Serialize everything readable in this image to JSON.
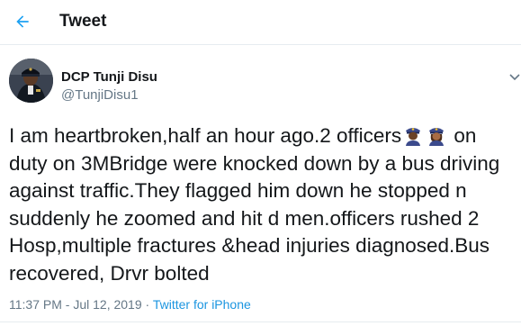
{
  "header": {
    "title": "Tweet",
    "back_icon": "arrow-left-icon",
    "accent": "#1da1f2"
  },
  "author": {
    "name": "DCP Tunji Disu",
    "handle": "@TunjiDisu1",
    "avatar_icon": "profile-photo"
  },
  "tweet": {
    "lines": [
      {
        "before": "I am heartbroken,half an hour ago.2 officers",
        "after": "on",
        "emoji": [
          "police-officer-icon",
          "police-officer-icon"
        ]
      },
      {
        "text": "duty on 3MBridge were knocked down by a bus driving"
      },
      {
        "text": "against traffic.They flagged him down he stopped n"
      },
      {
        "text": "suddenly he zoomed and hit d men.officers rushed 2"
      },
      {
        "text": "Hosp,multiple fractures &head injuries diagnosed.Bus"
      },
      {
        "text": "recovered, Drvr bolted"
      }
    ]
  },
  "meta": {
    "time": "11:37 PM",
    "separator": " · ",
    "date": "Jul 12, 2019",
    "source": "Twitter for iPhone"
  },
  "colors": {
    "text": "#14171a",
    "secondary": "#657786",
    "link": "#1b95e0",
    "divider": "#e6ecf0"
  }
}
